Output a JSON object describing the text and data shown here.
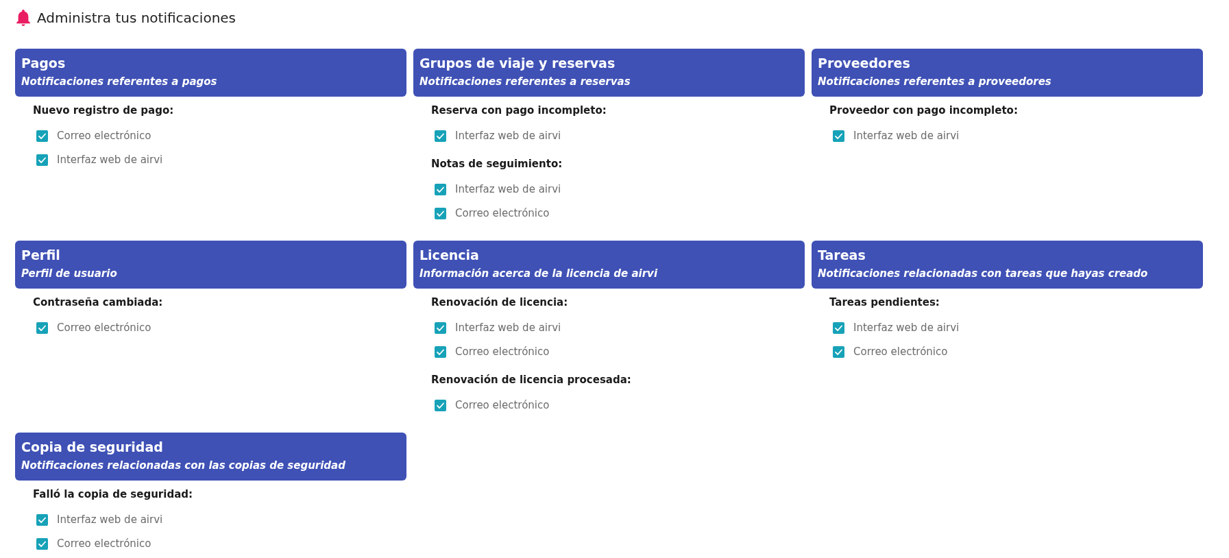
{
  "page": {
    "title": "Administra tus notificaciones"
  },
  "cards": [
    {
      "title": "Pagos",
      "subtitle": "Notificaciones referentes a pagos",
      "sections": [
        {
          "label": "Nuevo registro de pago:",
          "options": [
            {
              "label": "Correo electrónico",
              "checked": true
            },
            {
              "label": "Interfaz web de airvi",
              "checked": true
            }
          ]
        }
      ]
    },
    {
      "title": "Grupos de viaje y reservas",
      "subtitle": "Notificaciones referentes a reservas",
      "sections": [
        {
          "label": "Reserva con pago incompleto:",
          "options": [
            {
              "label": "Interfaz web de airvi",
              "checked": true
            }
          ]
        },
        {
          "label": "Notas de seguimiento:",
          "options": [
            {
              "label": "Interfaz web de airvi",
              "checked": true
            },
            {
              "label": "Correo electrónico",
              "checked": true
            }
          ]
        }
      ]
    },
    {
      "title": "Proveedores",
      "subtitle": "Notificaciones referentes a proveedores",
      "sections": [
        {
          "label": "Proveedor con pago incompleto:",
          "options": [
            {
              "label": "Interfaz web de airvi",
              "checked": true
            }
          ]
        }
      ]
    },
    {
      "title": "Perfil",
      "subtitle": "Perfil de usuario",
      "sections": [
        {
          "label": "Contraseña cambiada:",
          "options": [
            {
              "label": "Correo electrónico",
              "checked": true
            }
          ]
        }
      ]
    },
    {
      "title": "Licencia",
      "subtitle": "Información acerca de la licencia de airvi",
      "sections": [
        {
          "label": "Renovación de licencia:",
          "options": [
            {
              "label": "Interfaz web de airvi",
              "checked": true
            },
            {
              "label": "Correo electrónico",
              "checked": true
            }
          ]
        },
        {
          "label": "Renovación de licencia procesada:",
          "options": [
            {
              "label": "Correo electrónico",
              "checked": true
            }
          ]
        }
      ]
    },
    {
      "title": "Tareas",
      "subtitle": "Notificaciones relacionadas con tareas que hayas creado",
      "sections": [
        {
          "label": "Tareas pendientes:",
          "options": [
            {
              "label": "Interfaz web de airvi",
              "checked": true
            },
            {
              "label": "Correo electrónico",
              "checked": true
            }
          ]
        }
      ]
    },
    {
      "title": "Copia de seguridad",
      "subtitle": "Notificaciones relacionadas con las copias de seguridad",
      "sections": [
        {
          "label": "Falló la copia de seguridad:",
          "options": [
            {
              "label": "Interfaz web de airvi",
              "checked": true
            },
            {
              "label": "Correo electrónico",
              "checked": true
            }
          ]
        }
      ]
    }
  ]
}
